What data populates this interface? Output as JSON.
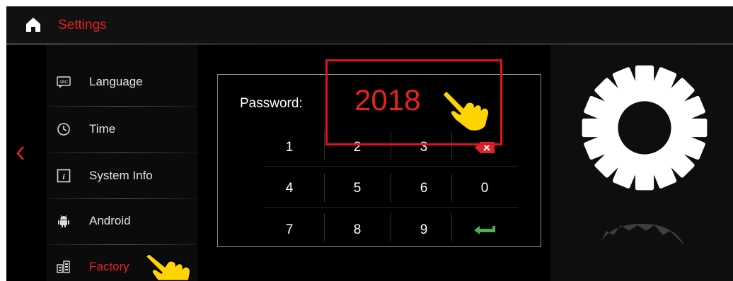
{
  "header": {
    "title": "Settings",
    "home_icon": "home-icon"
  },
  "sidebar": {
    "items": [
      {
        "label": "Language",
        "icon": "language-icon"
      },
      {
        "label": "Time",
        "icon": "clock-icon"
      },
      {
        "label": "System Info",
        "icon": "info-icon"
      },
      {
        "label": "Android",
        "icon": "android-icon"
      },
      {
        "label": "Factory",
        "icon": "factory-icon",
        "active": true
      }
    ]
  },
  "keypad": {
    "password_label": "Password:",
    "password_value": "2018",
    "keys": [
      "1",
      "2",
      "3",
      "4",
      "5",
      "6",
      "0",
      "7",
      "8",
      "9"
    ],
    "delete_icon": "backspace-icon",
    "enter_icon": "enter-icon"
  },
  "colors": {
    "accent": "#e8221c",
    "enter": "#4caf50",
    "highlight": "#e0141c",
    "hand": "#ffd400"
  }
}
